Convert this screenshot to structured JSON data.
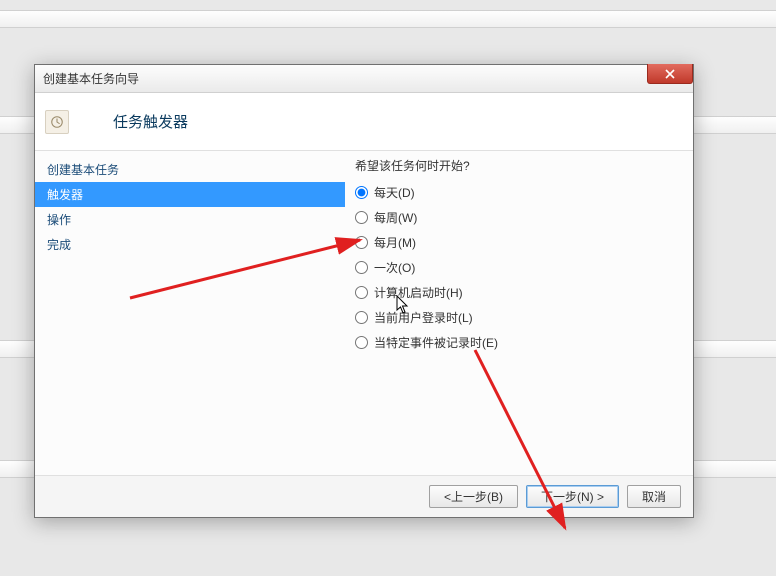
{
  "dialog": {
    "title": "创建基本任务向导",
    "header_title": "任务触发器"
  },
  "sidebar": {
    "items": [
      {
        "label": "创建基本任务",
        "selected": false
      },
      {
        "label": "触发器",
        "selected": true
      },
      {
        "label": "操作",
        "selected": false
      },
      {
        "label": "完成",
        "selected": false
      }
    ]
  },
  "content": {
    "prompt": "希望该任务何时开始?",
    "options": [
      {
        "label": "每天(D)",
        "checked": true
      },
      {
        "label": "每周(W)",
        "checked": false
      },
      {
        "label": "每月(M)",
        "checked": false
      },
      {
        "label": "一次(O)",
        "checked": false
      },
      {
        "label": "计算机启动时(H)",
        "checked": false
      },
      {
        "label": "当前用户登录时(L)",
        "checked": false
      },
      {
        "label": "当特定事件被记录时(E)",
        "checked": false
      }
    ]
  },
  "footer": {
    "back": "<上一步(B)",
    "next": "下一步(N) >",
    "cancel": "取消"
  }
}
